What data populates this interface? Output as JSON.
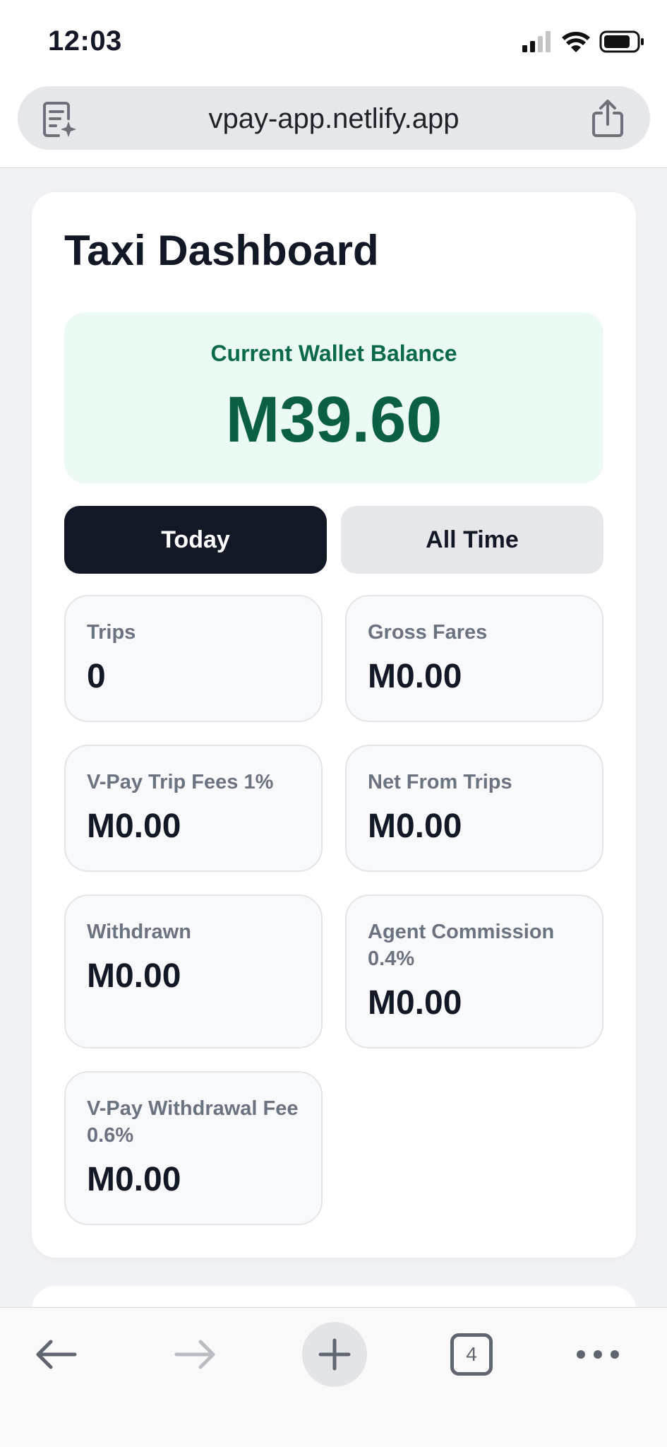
{
  "status_bar": {
    "time": "12:03"
  },
  "browser": {
    "url": "vpay-app.netlify.app",
    "tab_count": "4"
  },
  "dashboard": {
    "title": "Taxi Dashboard",
    "wallet": {
      "label": "Current Wallet Balance",
      "value": "M39.60"
    },
    "tabs": [
      {
        "label": "Today",
        "selected": true
      },
      {
        "label": "All Time",
        "selected": false
      }
    ],
    "stats": [
      {
        "label": "Trips",
        "value": "0"
      },
      {
        "label": "Gross Fares",
        "value": "M0.00"
      },
      {
        "label": "V-Pay Trip Fees 1%",
        "value": "M0.00"
      },
      {
        "label": "Net From Trips",
        "value": "M0.00"
      },
      {
        "label": "Withdrawn",
        "value": "M0.00"
      },
      {
        "label": "Agent Commission 0.4%",
        "value": "M0.00"
      },
      {
        "label": "V-Pay Withdrawal Fee 0.6%",
        "value": "M0.00"
      }
    ]
  },
  "colors": {
    "accent_green": "#0b5f45",
    "balance_bg": "#ebfaf2",
    "selected_tab": "#121826"
  }
}
